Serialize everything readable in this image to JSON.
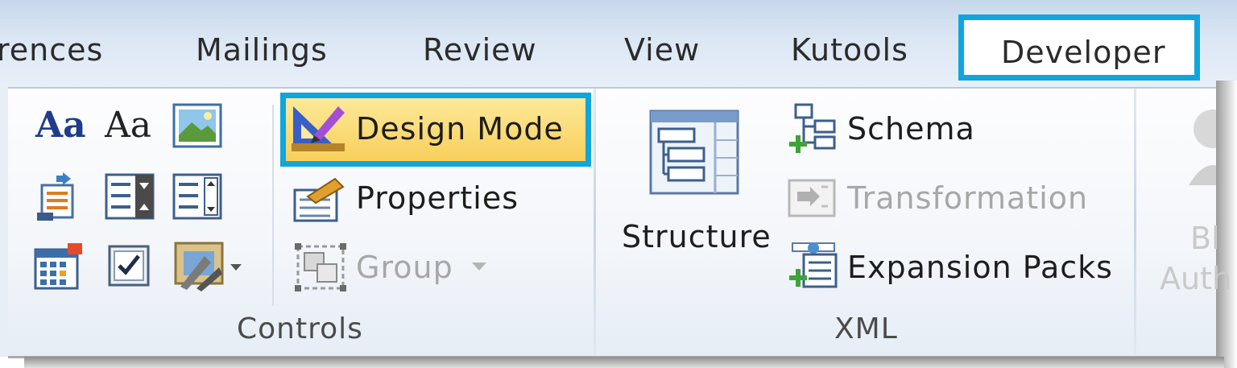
{
  "tabs": {
    "references": "rences",
    "mailings": "Mailings",
    "review": "Review",
    "view": "View",
    "kutools": "Kutools",
    "developer": "Developer"
  },
  "controls": {
    "rich_text_glyph": "Aa",
    "plain_text_glyph": "Aa",
    "design_mode": "Design Mode",
    "properties": "Properties",
    "group": "Group",
    "group_label": "Controls"
  },
  "xml": {
    "structure": "Structure",
    "schema": "Schema",
    "transformation": "Transformation",
    "expansion_packs": "Expansion Packs",
    "group_label": "XML"
  },
  "protect": {
    "line1": "Bl",
    "line2": "Auth"
  },
  "colors": {
    "highlight_border": "#10a6dc",
    "design_mode_fill": "#f8cf5a"
  },
  "icons": [
    "picture-content-control-icon",
    "building-block-gallery-icon",
    "combo-box-icon",
    "dropdown-list-icon",
    "date-picker-icon",
    "checkbox-icon",
    "legacy-tools-icon",
    "design-mode-icon",
    "properties-icon",
    "group-icon",
    "structure-icon",
    "schema-icon",
    "transformation-icon",
    "expansion-packs-icon",
    "block-authors-icon"
  ]
}
